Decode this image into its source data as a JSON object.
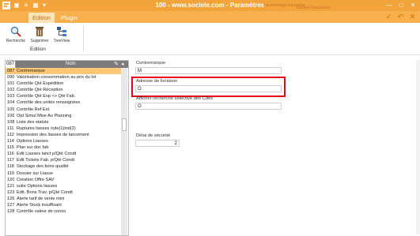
{
  "window": {
    "title": "100 - www.societe.com - Paramètres",
    "faded_text_1": "Paramétrage entreprise",
    "faded_text_2": "Société Facturation"
  },
  "ribbon": {
    "tabs": [
      {
        "label": "Edition",
        "active": true
      },
      {
        "label": "Plugin",
        "active": false
      }
    ],
    "buttons": [
      {
        "label": "Recherche",
        "icon": "search-icon"
      },
      {
        "label": "Supprimer",
        "icon": "trash-icon"
      },
      {
        "label": "TreeView",
        "icon": "treeview-icon"
      }
    ],
    "group_label": "Edition"
  },
  "list": {
    "header": {
      "code": "087",
      "name": "Nom"
    },
    "rows": [
      {
        "code": "087",
        "name": "Contremarque",
        "selected": true
      },
      {
        "code": "090",
        "name": "Valorisation consommation au prix du lot"
      },
      {
        "code": "101",
        "name": "Contrôle Qté Expédition"
      },
      {
        "code": "102",
        "name": "Contrôle Qté Réception"
      },
      {
        "code": "103",
        "name": "Contrôle Qté Exp <> Qté Fab."
      },
      {
        "code": "104",
        "name": "Contrôle des unités renseignées"
      },
      {
        "code": "105",
        "name": "Contrôle Ref Ext."
      },
      {
        "code": "106",
        "name": "Opt Simul Mise Au Planning"
      },
      {
        "code": "108",
        "name": "Liste des statuts"
      },
      {
        "code": "111",
        "name": "Ruptures liasses /cde(1)ind(2)"
      },
      {
        "code": "112",
        "name": "Impression des liasses de lancement"
      },
      {
        "code": "114",
        "name": "Options Liasses"
      },
      {
        "code": "115",
        "name": "Plan sur doc fab"
      },
      {
        "code": "116",
        "name": "Edit Liasses lanct p/Qté Condt"
      },
      {
        "code": "117",
        "name": "Edit Tickets Fab. p/Qté Condt"
      },
      {
        "code": "118",
        "name": "Stockage des bons qualité"
      },
      {
        "code": "119",
        "name": "Dossier sur Liasse"
      },
      {
        "code": "120",
        "name": "Création Offre SAV"
      },
      {
        "code": "121",
        "name": "suite Options liasses"
      },
      {
        "code": "123",
        "name": "Edit. Bons Trav. p/Qté Condt"
      },
      {
        "code": "126",
        "name": "Alerte tarif de vente mini"
      },
      {
        "code": "127",
        "name": "Alerte Stock insuffisant"
      },
      {
        "code": "128",
        "name": "Contrôle valeur de conso"
      }
    ]
  },
  "form": {
    "contremarque": {
      "label": "Contremarque",
      "value": "M"
    },
    "adresse": {
      "label": "Adresse de livraison",
      "value": "O"
    },
    "recherche": {
      "label": "Afficher recherche sélective des Cdes",
      "value": "O"
    },
    "delai": {
      "label": "Délai de sécurité",
      "value": "2"
    }
  },
  "colors": {
    "titlebar": "#f2a33a",
    "tab_active_bg": "#fce4b8",
    "selected_row": "#ffc775",
    "highlight_border": "#e30613"
  }
}
